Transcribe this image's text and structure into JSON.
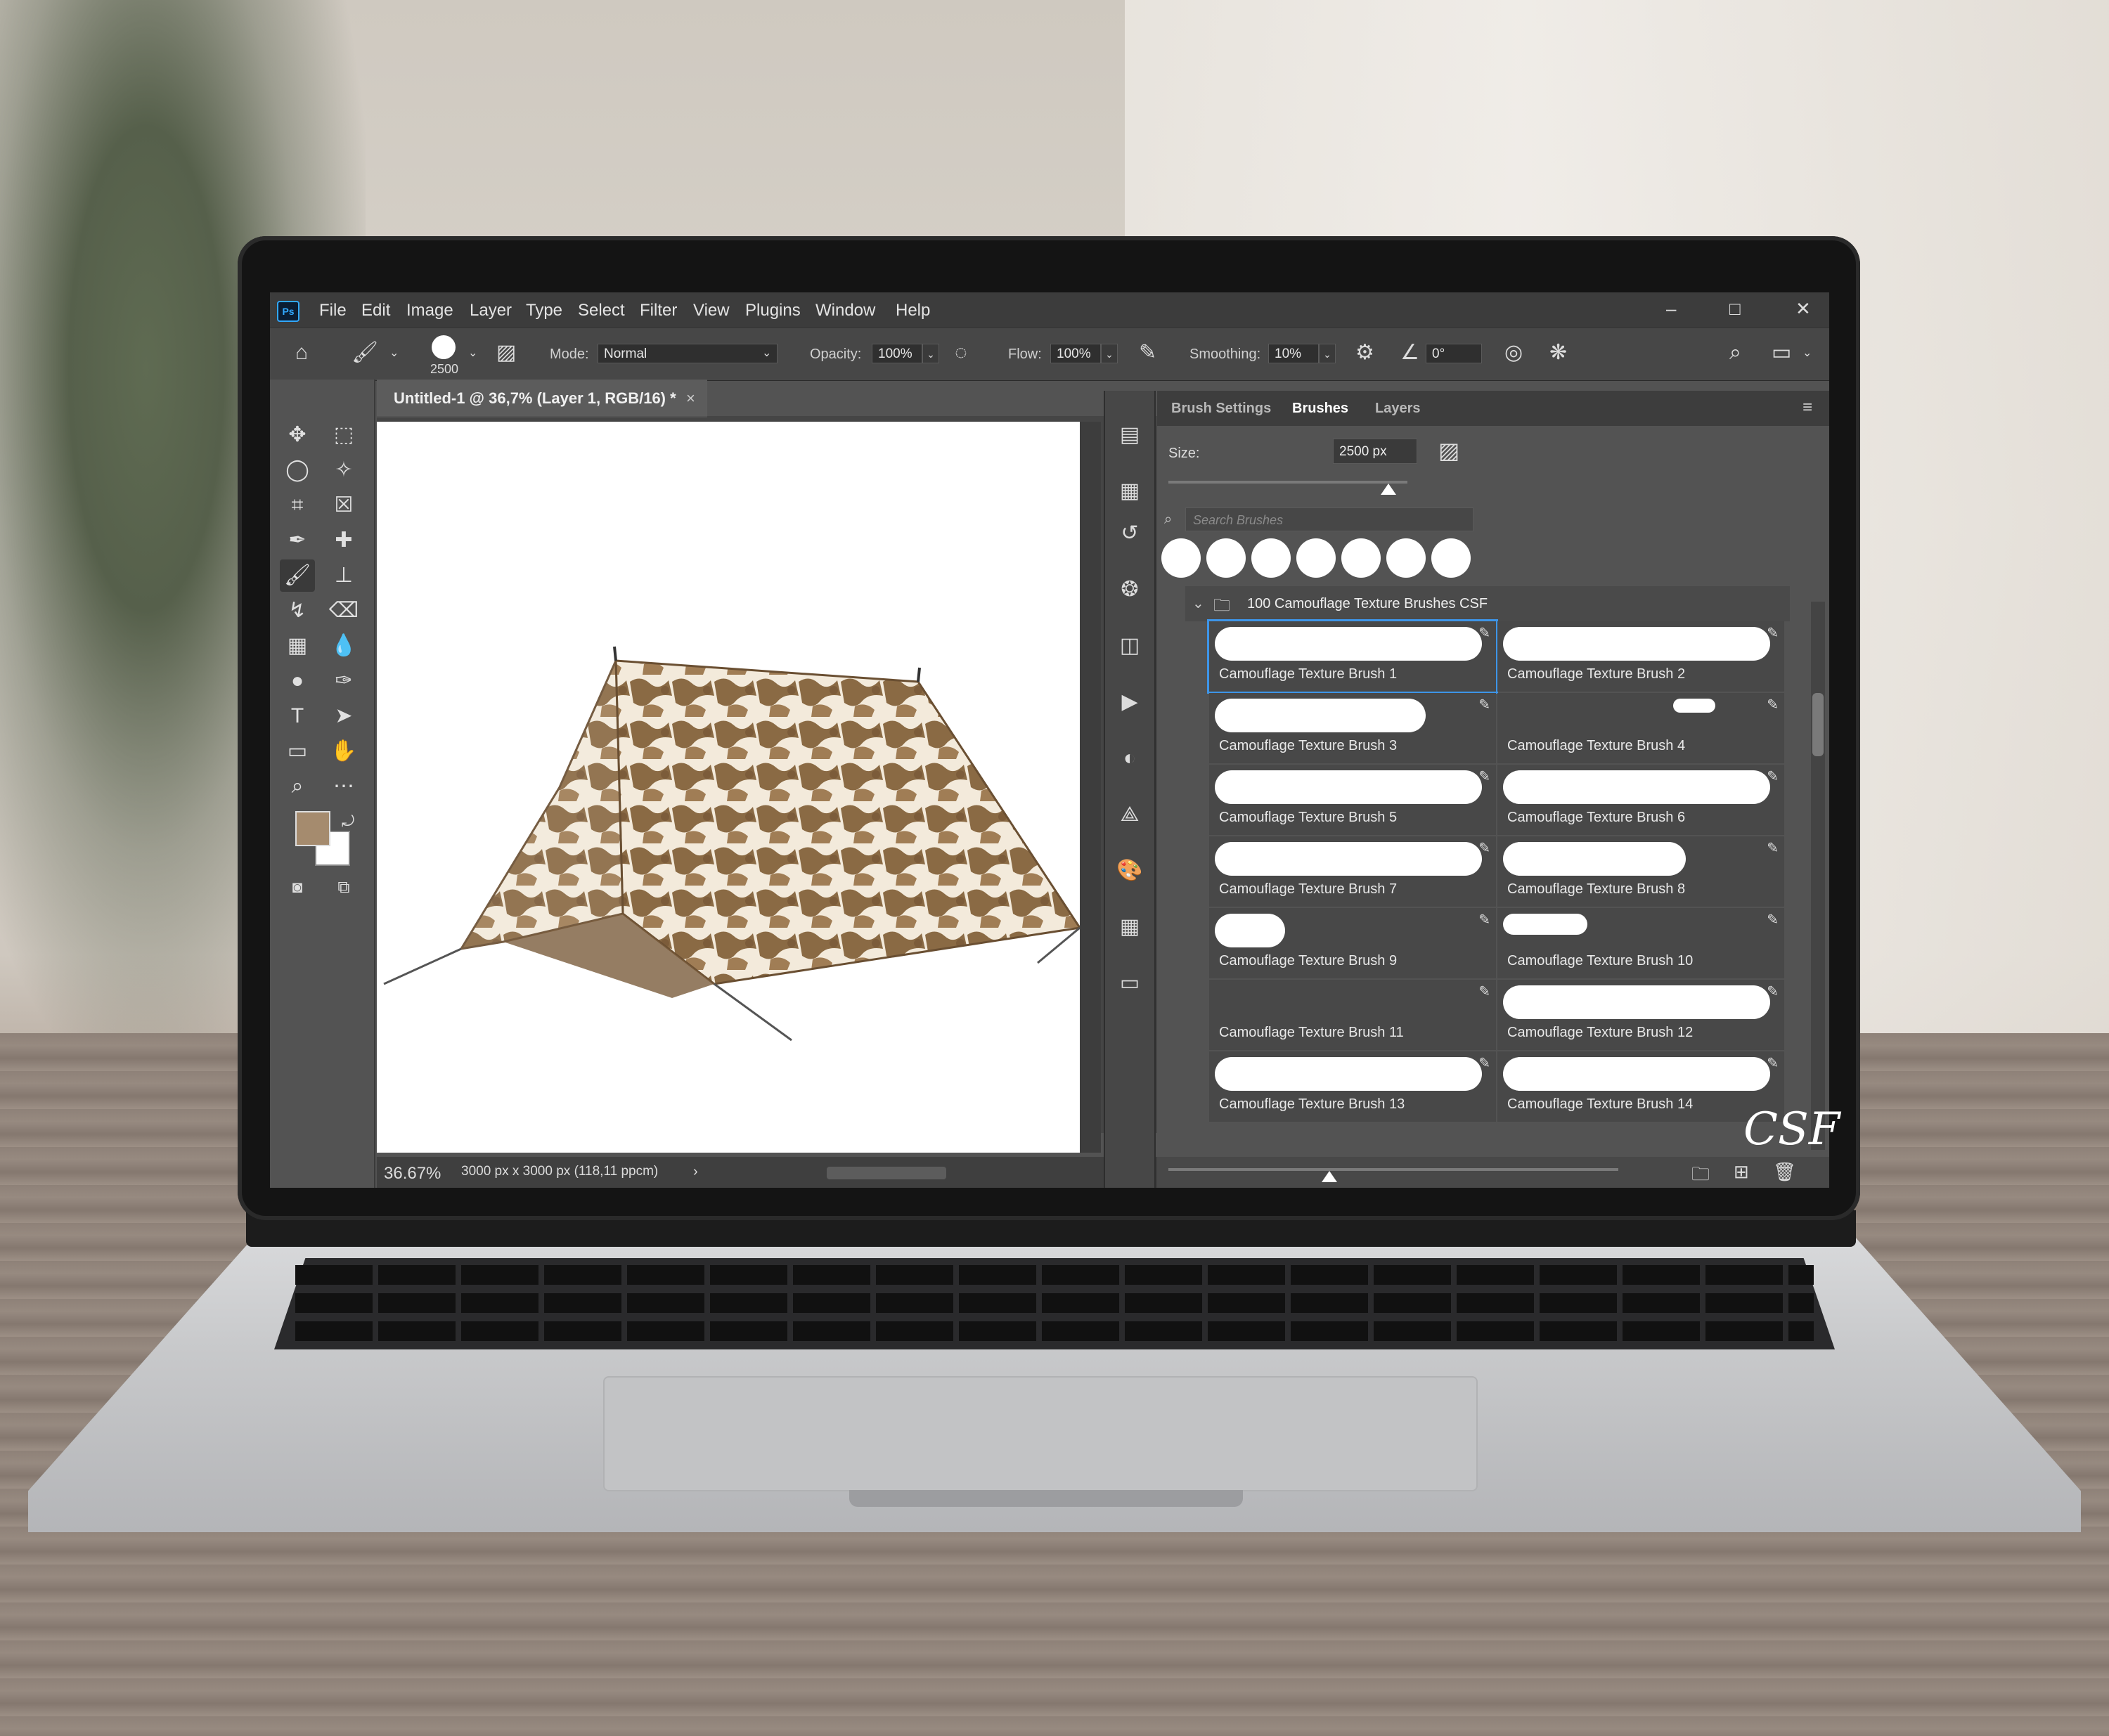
{
  "menubar": {
    "app_icon": "Ps",
    "items": [
      "File",
      "Edit",
      "Image",
      "Layer",
      "Type",
      "Select",
      "Filter",
      "View",
      "Plugins",
      "Window",
      "Help"
    ]
  },
  "options": {
    "brush_size_label": "2500",
    "mode_label": "Mode:",
    "mode_value": "Normal",
    "opacity_label": "Opacity:",
    "opacity_value": "100%",
    "flow_label": "Flow:",
    "flow_value": "100%",
    "smoothing_label": "Smoothing:",
    "smoothing_value": "10%",
    "angle_value": "0°"
  },
  "document": {
    "tab_title": "Untitled-1 @ 36,7% (Layer 1, RGB/16) *",
    "close_glyph": "×",
    "zoom": "36.67%",
    "doc_info": "3000 px x 3000 px (118,11 ppcm)"
  },
  "colors": {
    "foreground": "#a58b6e",
    "background": "#ffffff",
    "accent": "#3d95e8"
  },
  "panel": {
    "tabs": [
      "Brush Settings",
      "Brushes",
      "Layers"
    ],
    "active_tab": "Brushes",
    "size_label": "Size:",
    "size_value": "2500 px",
    "search_placeholder": "Search Brushes",
    "folder_name": "100 Camouflage Texture Brushes CSF",
    "brushes": [
      "Camouflage Texture Brush 1",
      "Camouflage Texture Brush 2",
      "Camouflage Texture Brush 3",
      "Camouflage Texture Brush 4",
      "Camouflage Texture Brush 5",
      "Camouflage Texture Brush 6",
      "Camouflage Texture Brush 7",
      "Camouflage Texture Brush 8",
      "Camouflage Texture Brush 9",
      "Camouflage Texture Brush 10",
      "Camouflage Texture Brush 11",
      "Camouflage Texture Brush 12",
      "Camouflage Texture Brush 13",
      "Camouflage Texture Brush 14"
    ],
    "selected_brush_index": 0
  },
  "watermark": "CSF"
}
